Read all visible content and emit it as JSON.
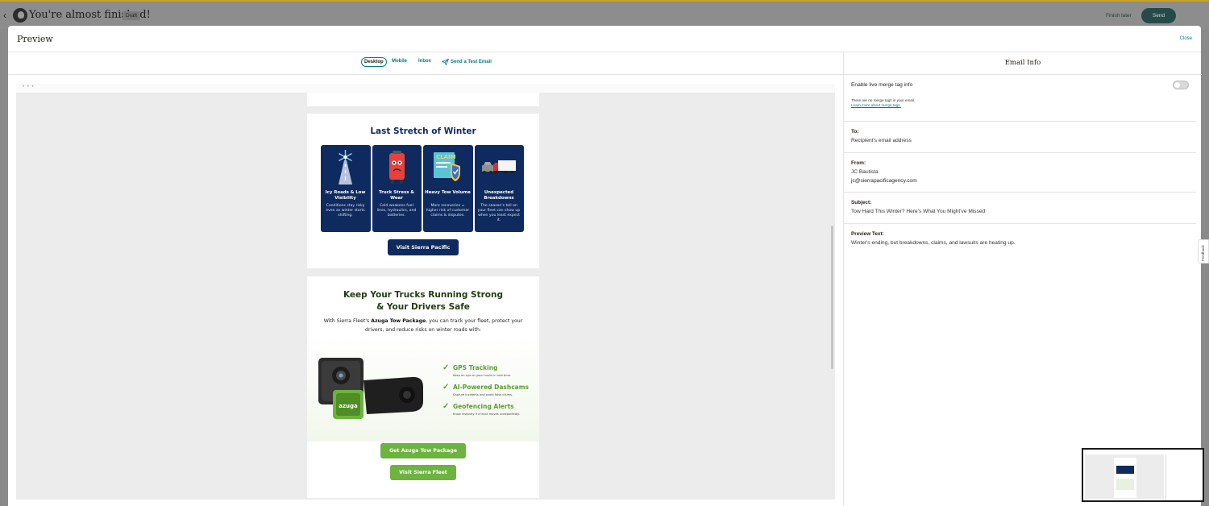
{
  "topbar": {
    "title": "You're almost finished!",
    "badge": "Draft",
    "finish_later": "Finish later",
    "send": "Send"
  },
  "modal": {
    "heading": "Preview",
    "close": "Close"
  },
  "tabs": {
    "desktop": "Desktop",
    "mobile": "Mobile",
    "inbox": "Inbox",
    "test_email": "Send a Test Email"
  },
  "email": {
    "winter_title": "Last Stretch of Winter",
    "tiles": [
      {
        "title": "Icy Roads & Low Visibility",
        "body": "Conditions stay risky even as winter starts shifting.",
        "icon": "snowflake-road-icon"
      },
      {
        "title": "Truck Stress & Wear",
        "body": "Cold weakens fuel lines, hydraulics, and batteries.",
        "icon": "battery-character-icon"
      },
      {
        "title": "Heavy Tow Volume",
        "body": "More recoveries = higher risk of customer claims & disputes.",
        "icon": "claim-shield-icon"
      },
      {
        "title": "Unexpected Breakdowns",
        "body": "The season's toll on your fleet can show up when you least expect it.",
        "icon": "tow-truck-icon"
      }
    ],
    "visit_pacific": "Visit Sierra Pacific",
    "keep_title_1": "Keep Your Trucks Running Strong",
    "keep_title_2": "& Your Drivers Safe",
    "keep_body_prefix": "With Sierra Fleet's ",
    "keep_body_bold": "Azuga Tow Package",
    "keep_body_suffix": ", you can track your fleet, protect your drivers, and reduce risks on winter roads with:",
    "device_brand": "azuga",
    "features": [
      {
        "title": "GPS Tracking",
        "desc": "Keep an eye on your trucks in real time."
      },
      {
        "title": "AI-Powered Dashcams",
        "desc": "Capture incidents and avoid false claims."
      },
      {
        "title": "Geofencing Alerts",
        "desc": "Know instantly if a truck moves unexpectedly."
      }
    ],
    "get_azuga": "Get Azuga Tow Package",
    "visit_fleet": "Visit Sierra Fleet"
  },
  "info": {
    "heading": "Email Info",
    "merge_label": "Enable live merge tag info",
    "merge_toggle_on": false,
    "merge_note": "There are no merge tags in your email.",
    "merge_link": "Learn more about merge tags.",
    "to_label": "To:",
    "to_value": "Recipient's email address",
    "from_label": "From:",
    "from_name": "JC Bautista",
    "from_email": "jc@sierrapacificagency.com",
    "subject_label": "Subject:",
    "subject_value": "Tow Hard This Winter? Here's What You Might've Missed",
    "preview_label": "Preview Text:",
    "preview_value": "Winter's ending, but breakdowns, claims, and lawsuits are heating up."
  },
  "feedback": "Feedback",
  "colors": {
    "navy": "#0e2a5e",
    "green": "#6db33f",
    "teal": "#007c89",
    "send_button": "#254a47"
  }
}
